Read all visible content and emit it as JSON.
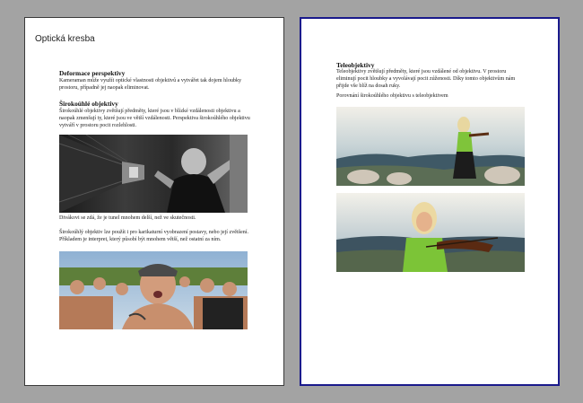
{
  "left_page": {
    "title": "Optická kresba",
    "section1": {
      "heading": "Deformace perspektivy",
      "text": "Kameraman může využít optické vlastnosti objektivů a vytvářet tak dojem hloubky prostoru, případně jej naopak eliminovat."
    },
    "section2": {
      "heading": "Širokoúhlé objektivy",
      "text": "Širokoúhlé objektivy zvětšují předměty, které jsou v blízké vzdálenosti objektivu a naopak zmenšují ty, které jsou ve větší vzdálenosti. Perspektiva širokoúhlého objektivu vytváří v prostoru pocit rozlehlosti.",
      "caption": "Divákovi se zdá, že je tunel mnohem delší, než ve skutečnosti.",
      "text2": "Širokoúhlý objektiv lze použít i pro karikaturní vyobrazení postavy, nebo její zvětšení. Příkladem je interpret, který působí být mnohem větší, než ostatní za ním."
    }
  },
  "right_page": {
    "section": {
      "heading": "Teleobjektivy",
      "text": "Teleobjektivy zvětšují předměty, které jsou vzdálené od objektivu. V prostoru eliminují pocit hloubky a vyvolávají pocit zúženosti. Díky tomto objektivům nám přijde vše blíž na dosah ruky.",
      "caption": "Porovnání širokoúhlého objektivu s teleobjektivem"
    }
  },
  "colors": {
    "workspace": "#a3a3a3",
    "active_page_border": "#1a1a8c",
    "page_border": "#3a3a3a"
  }
}
